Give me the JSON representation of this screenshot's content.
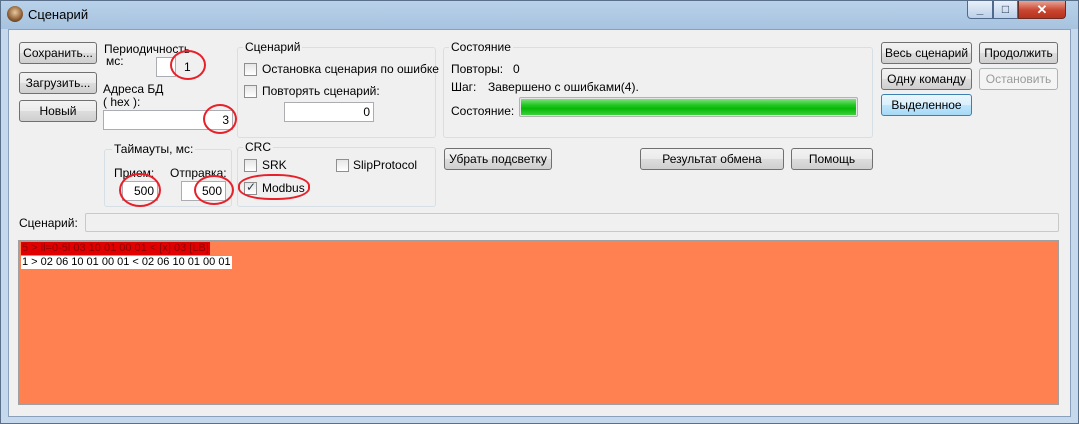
{
  "window": {
    "title": "Сценарий",
    "icon": "app-icon",
    "controls": {
      "minimize": "_",
      "maximize": "□",
      "close": "✕"
    }
  },
  "file_buttons": {
    "save": "Сохранить...",
    "load": "Загрузить...",
    "new": "Новый"
  },
  "period": {
    "label_line1": "Периодичность",
    "label_line2": "мс:",
    "value": "1"
  },
  "db_address": {
    "label_line1": "Адреса БД",
    "label_line2": "( hex ):",
    "value": "3"
  },
  "timeouts": {
    "legend": "Таймауты, мс:",
    "receive_label": "Прием:",
    "receive_value": "500",
    "send_label": "Отправка:",
    "send_value": "500"
  },
  "scenario_group": {
    "legend": "Сценарий",
    "stop_on_error": {
      "label": "Остановка сценария по ошибке",
      "checked": false
    },
    "repeat": {
      "label": "Повторять сценарий:",
      "checked": false,
      "value": "0"
    }
  },
  "crc_group": {
    "legend": "CRC",
    "srk": {
      "label": "SRK",
      "checked": false
    },
    "slip": {
      "label": "SlipProtocol",
      "checked": false
    },
    "modbus": {
      "label": "Modbus",
      "checked": true
    }
  },
  "status_group": {
    "legend": "Состояние",
    "repeats_label": "Повторы:",
    "repeats_value": "0",
    "step_label": "Шаг:",
    "step_value": "Завершено с ошибками(4).",
    "state_label": "Состояние:",
    "progress_fraction": 1.0,
    "progress_color": "#07b807"
  },
  "middle_buttons": {
    "clear_highlight": "Убрать подсветку",
    "exchange_result": "Результат обмена",
    "help": "Помощь"
  },
  "run_buttons": {
    "whole_scenario": "Весь сценарий",
    "continue": "Продолжить",
    "one_command": "Одну команду",
    "stop": "Остановить",
    "selected": "Выделенное"
  },
  "scenario_line": {
    "label": "Сценарий:",
    "value": ""
  },
  "log": {
    "background": "#ff8050",
    "lines": [
      {
        "text": "5 > ll=0-5l 03 10 01 00 01 < [x] 03 [LB]",
        "style": "error"
      },
      {
        "text": "1 > 02 06 10 01 00 01 < 02 06 10 01 00 01",
        "style": "normal"
      }
    ]
  }
}
